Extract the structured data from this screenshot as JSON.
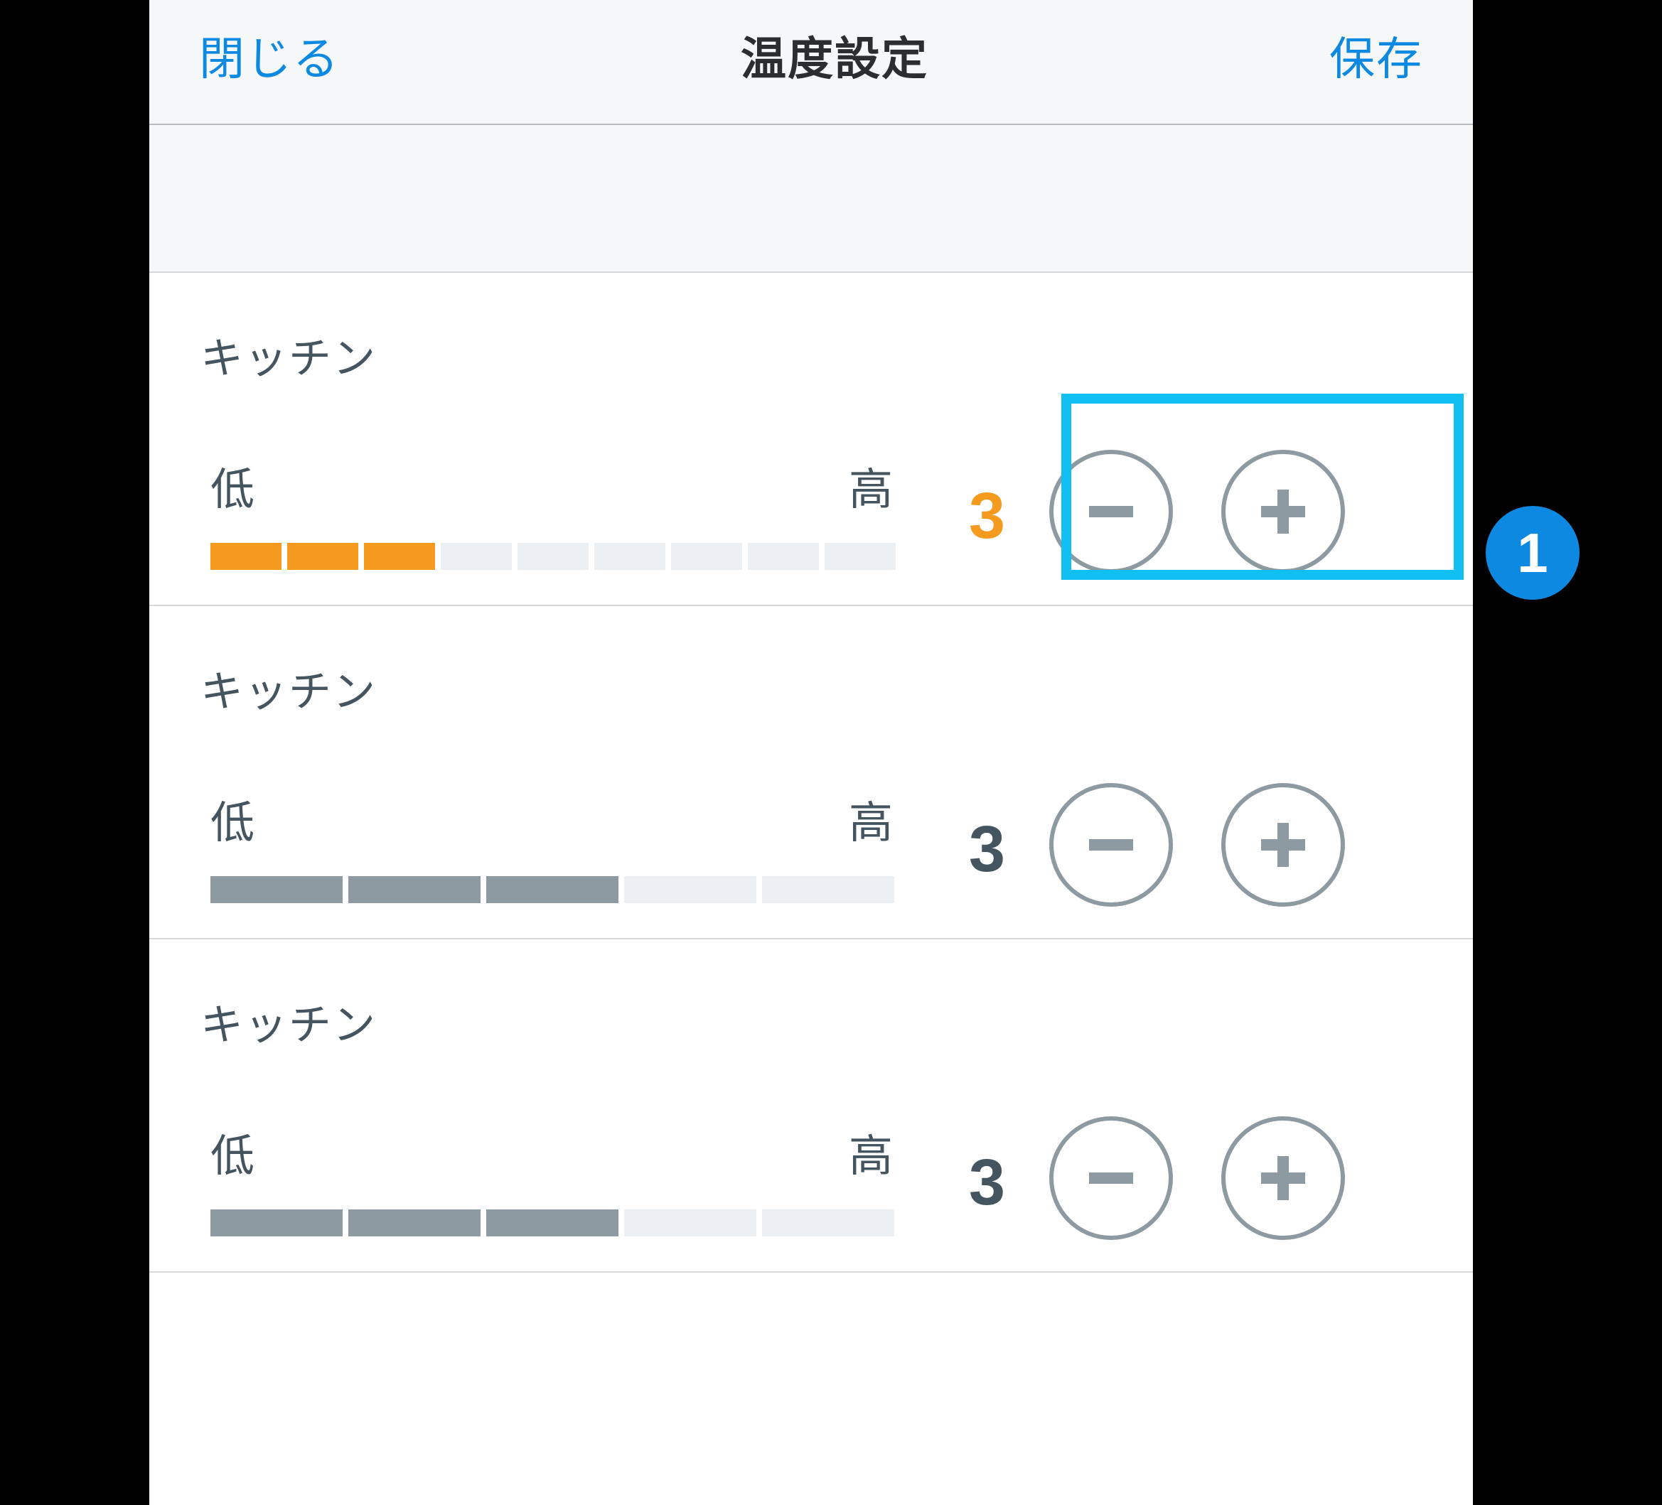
{
  "header": {
    "close_label": "閉じる",
    "title": "温度設定",
    "save_label": "保存"
  },
  "annotation": {
    "badge": "1"
  },
  "rows": [
    {
      "name": "キッチン",
      "low_label": "低",
      "high_label": "高",
      "value": "3",
      "value_color": "orange",
      "segments_total": 9,
      "segments_filled": 3,
      "fill_style": "orange",
      "highlighted": true
    },
    {
      "name": "キッチン",
      "low_label": "低",
      "high_label": "高",
      "value": "3",
      "value_color": "gray",
      "segments_total": 5,
      "segments_filled": 3,
      "fill_style": "gray",
      "highlighted": false
    },
    {
      "name": "キッチン",
      "low_label": "低",
      "high_label": "高",
      "value": "3",
      "value_color": "gray",
      "segments_total": 5,
      "segments_filled": 3,
      "fill_style": "gray",
      "highlighted": false
    }
  ]
}
